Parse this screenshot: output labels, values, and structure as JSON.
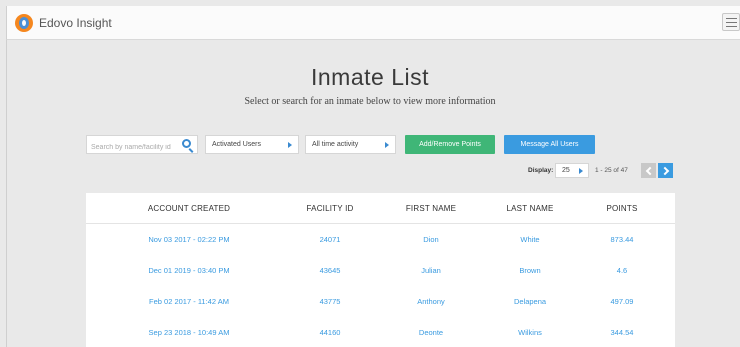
{
  "app": {
    "title": "Edovo Insight"
  },
  "page": {
    "title": "Inmate List",
    "subtitle": "Select or search for an inmate below to view more information"
  },
  "toolbar": {
    "search_placeholder": "Search by name/facility id",
    "user_filter": "Activated Users",
    "activity_filter": "All time activity",
    "add_remove_points_label": "Add/Remove Points",
    "message_all_label": "Message All Users"
  },
  "pagination": {
    "display_label": "Display:",
    "display_value": "25",
    "range_text": "1 - 25 of 47"
  },
  "table": {
    "columns": [
      "ACCOUNT CREATED",
      "FACILITY ID",
      "FIRST NAME",
      "LAST NAME",
      "POINTS"
    ],
    "rows": [
      [
        "Nov 03 2017 - 02:22 PM",
        "24071",
        "Dion",
        "White",
        "873.44"
      ],
      [
        "Dec 01 2019 - 03:40 PM",
        "43645",
        "Julian",
        "Brown",
        "4.6"
      ],
      [
        "Feb 02 2017 - 11:42 AM",
        "43775",
        "Anthony",
        "Delapena",
        "497.09"
      ],
      [
        "Sep 23 2018 - 10:49 AM",
        "44160",
        "Deonte",
        "Wilkins",
        "344.54"
      ]
    ]
  },
  "colors": {
    "accent": "#3a9be0",
    "green": "#3fb677",
    "logo": "#f5871f"
  }
}
